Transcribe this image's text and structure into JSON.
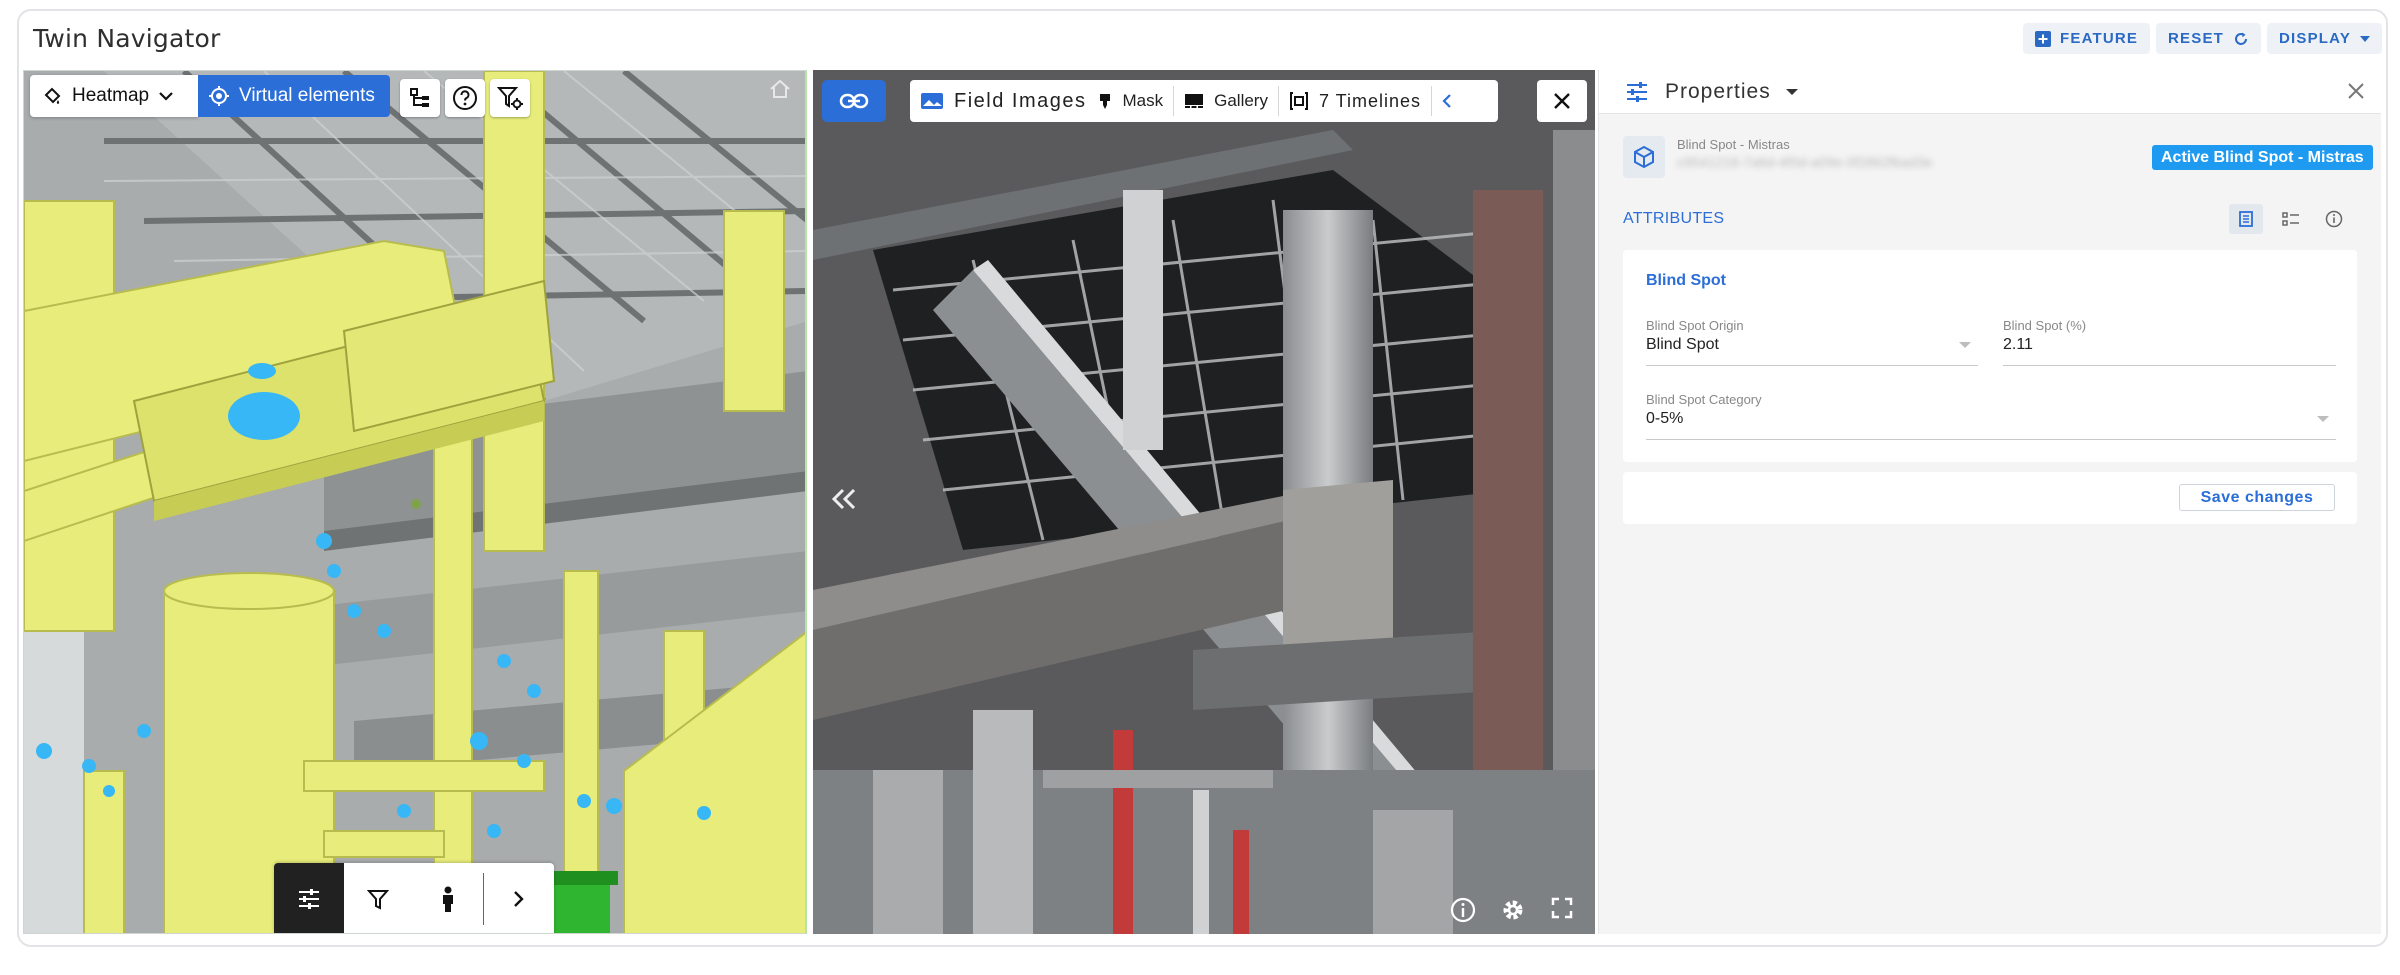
{
  "app": {
    "title": "Twin Navigator"
  },
  "header": {
    "feature_label": "FEATURE",
    "reset_label": "RESET",
    "display_label": "DISPLAY"
  },
  "viewer3d": {
    "heatmap_label": "Heatmap",
    "virtual_elements_label": "Virtual elements",
    "colors": {
      "pipe": "#e7ec7a",
      "steel": "#8d9192",
      "marker": "#37b7f5",
      "active": "#2b6ed8"
    }
  },
  "image_viewer": {
    "field_images_label": "Field Images",
    "mask_label": "Mask",
    "gallery_label": "Gallery",
    "timelines_label": "7 Timelines"
  },
  "properties": {
    "title": "Properties",
    "entity_subtitle": "Blind Spot - Mistras",
    "entity_id": "c9541218-7a6d-4f0d-a09e-0f2862fbad3e",
    "active_badge": "Active Blind Spot - Mistras",
    "attributes_label": "ATTRIBUTES",
    "section_title": "Blind Spot",
    "fields": {
      "origin_label": "Blind Spot Origin",
      "origin_value": "Blind Spot",
      "percent_label": "Blind Spot (%)",
      "percent_value": "2.11",
      "category_label": "Blind Spot Category",
      "category_value": "0-5%"
    },
    "save_label": "Save changes"
  }
}
